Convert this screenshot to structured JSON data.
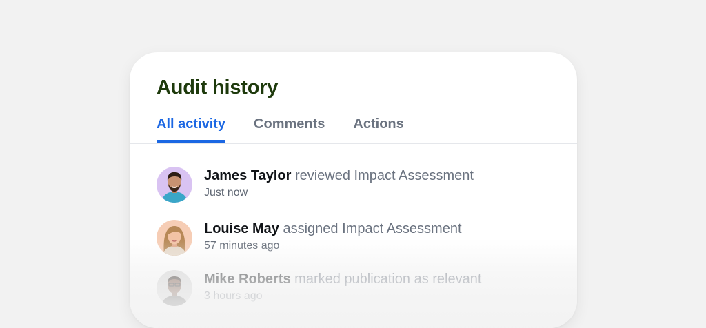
{
  "panel": {
    "title": "Audit history",
    "tabs": [
      {
        "label": "All activity",
        "active": true
      },
      {
        "label": "Comments",
        "active": false
      },
      {
        "label": "Actions",
        "active": false
      }
    ],
    "accent_color": "#1b67e3",
    "title_color": "#1e3a0c"
  },
  "activity": [
    {
      "actor": "James Taylor",
      "action": "reviewed Impact Assessment",
      "time": "Just now"
    },
    {
      "actor": "Louise May",
      "action": "assigned Impact Assessment",
      "time": "57 minutes ago"
    },
    {
      "actor": "Mike Roberts",
      "action": "marked publication as relevant",
      "time": "3 hours ago"
    }
  ]
}
